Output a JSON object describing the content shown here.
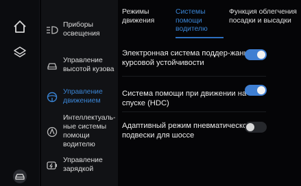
{
  "rail": {
    "icons": [
      "home-icon",
      "layers-icon",
      "vehicle-icon"
    ]
  },
  "sidebar": {
    "items": [
      {
        "label": "Приборы освещения",
        "icon": "lighting-icon",
        "active": false
      },
      {
        "label": "Управление высотой кузова",
        "icon": "car-height-icon",
        "active": false
      },
      {
        "label": "Управление движением",
        "icon": "steering-wheel-icon",
        "active": true
      },
      {
        "label": "Интеллектуаль-ные системы помощи водителю",
        "icon": "driver-assist-icon",
        "active": false
      },
      {
        "label": "Управление зарядкой",
        "icon": "charging-icon",
        "active": false
      }
    ]
  },
  "tabs": [
    {
      "label": "Режимы движения",
      "active": false
    },
    {
      "label": "Системы помощи водителю",
      "active": true
    },
    {
      "label": "Функция облегчения посадки и высадки",
      "active": false
    }
  ],
  "settings": [
    {
      "label": "Электронная система поддер-жания курсовой устойчивости",
      "enabled": true
    },
    {
      "label": "Система помощи при движении на спуске (HDC)",
      "enabled": true
    },
    {
      "label": "Адаптивный режим пневматической подвески для шоссе",
      "enabled": false
    }
  ],
  "colors": {
    "accent": "#3a85d6",
    "toggle_on": "#3f7fd2",
    "toggle_off": "#26282c",
    "background": "#050507",
    "sidebar": "#111215"
  }
}
